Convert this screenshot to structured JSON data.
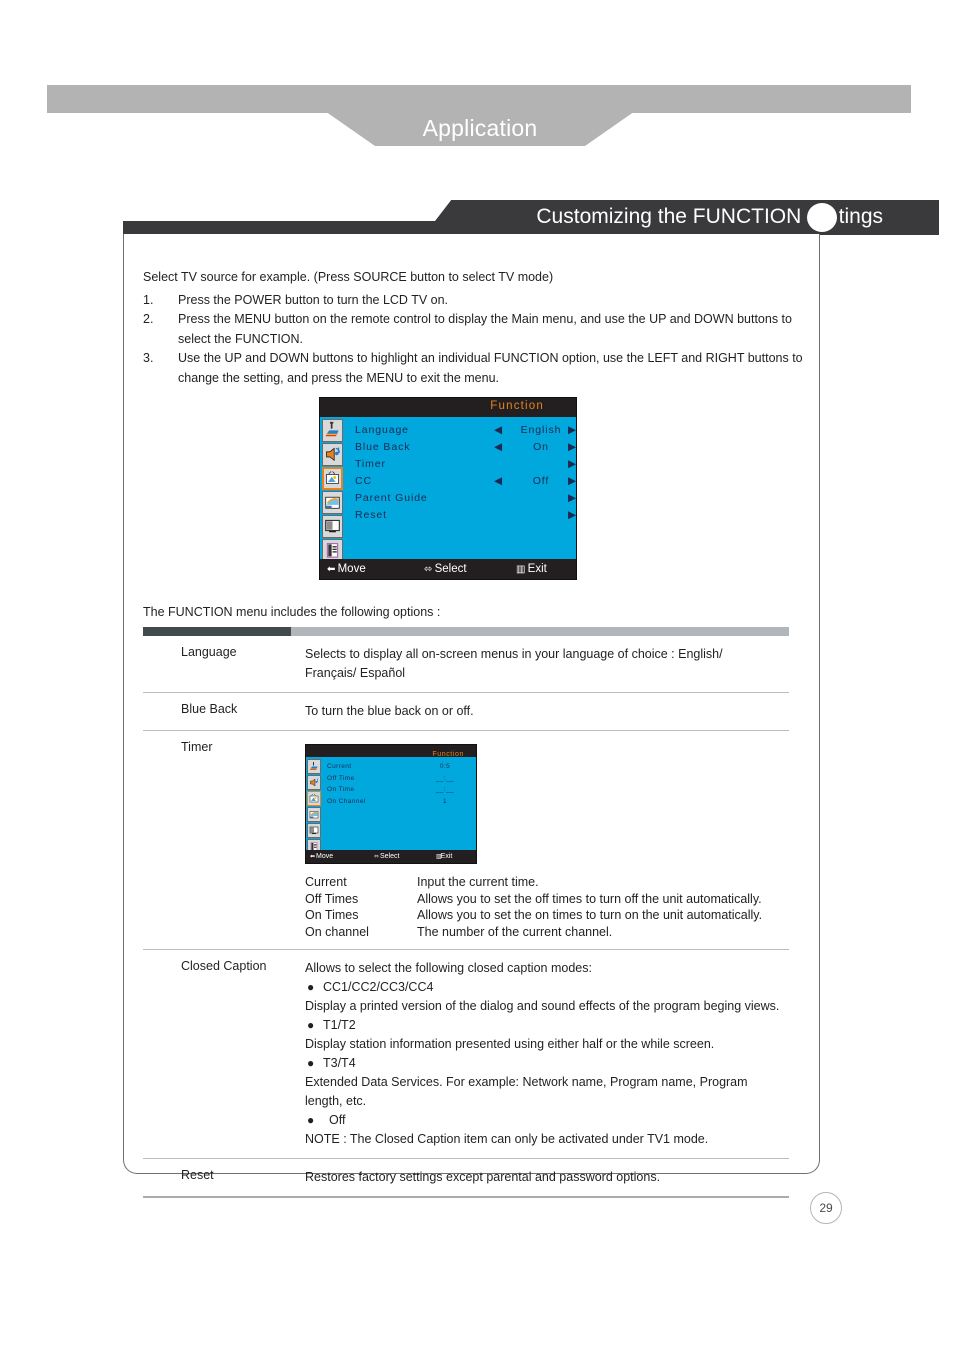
{
  "banner": {
    "chapter_title": "Application"
  },
  "section": {
    "title": "Customizing the FUNCTION Settings"
  },
  "intro": {
    "lead": "Select TV source for example. (Press SOURCE button to select TV mode)",
    "steps": [
      {
        "num": "1.",
        "text": "Press the POWER button to turn the LCD TV on."
      },
      {
        "num": "2.",
        "text": "Press the MENU button on the remote control to display the Main menu, and use the UP and DOWN buttons to select the FUNCTION."
      },
      {
        "num": "3.",
        "text": "Use the UP and DOWN buttons to highlight an individual FUNCTION option, use the LEFT and RIGHT buttons to change the setting, and press the MENU to exit the menu."
      }
    ]
  },
  "osd_main": {
    "title": "Function",
    "icons": [
      {
        "name": "picture-icon",
        "selected": false
      },
      {
        "name": "audio-icon",
        "selected": false
      },
      {
        "name": "function-icon",
        "selected": true
      },
      {
        "name": "setup-icon",
        "selected": false
      },
      {
        "name": "pip-icon",
        "selected": false
      },
      {
        "name": "input-icon",
        "selected": false
      }
    ],
    "rows": [
      {
        "label": "Language",
        "value": "English",
        "left_arrow": true,
        "right_arrow": true
      },
      {
        "label": "Blue Back",
        "value": "On",
        "left_arrow": true,
        "right_arrow": true
      },
      {
        "label": "Timer",
        "value": "",
        "left_arrow": false,
        "right_arrow": true
      },
      {
        "label": "CC",
        "value": "Off",
        "left_arrow": true,
        "right_arrow": true
      },
      {
        "label": "Parent Guide",
        "value": "",
        "left_arrow": false,
        "right_arrow": true
      },
      {
        "label": "Reset",
        "value": "",
        "left_arrow": false,
        "right_arrow": true
      }
    ],
    "footer": {
      "move": "Move",
      "select": "Select",
      "exit": "Exit",
      "move_glyph": "⬍",
      "select_glyph": "⬌",
      "exit_glyph": "▥"
    },
    "colors": {
      "body": "#00a8de",
      "titlebar": "#231f20",
      "title_text": "#e8821e",
      "row_text": "#1c2a52",
      "highlight": "#e8821e"
    }
  },
  "osd_timer": {
    "title": "Function",
    "icons": [
      {
        "name": "picture-icon",
        "selected": false
      },
      {
        "name": "audio-icon",
        "selected": false
      },
      {
        "name": "function-icon",
        "selected": true
      },
      {
        "name": "setup-icon",
        "selected": false
      },
      {
        "name": "pip-icon",
        "selected": false
      },
      {
        "name": "input-icon",
        "selected": false
      }
    ],
    "rows": [
      {
        "label": "Current",
        "value": "0:5"
      },
      {
        "label": "Off Time",
        "value": "__:__"
      },
      {
        "label": "On Time",
        "value": "__:__"
      },
      {
        "label": "On Channel",
        "value": "1"
      }
    ],
    "footer": {
      "move": "Move",
      "select": "Select",
      "exit": "Exit",
      "move_glyph": "⬍",
      "select_glyph": "⬌",
      "exit_glyph": "▥"
    }
  },
  "includes_line": "The FUNCTION menu includes the following options :",
  "table": {
    "language": {
      "term": "Language",
      "desc_line1": "Selects to display all on-screen menus in your language of choice : English/",
      "desc_line2": "Français/ Español"
    },
    "blue_back": {
      "term": "Blue Back",
      "desc": "To turn the blue back on or off."
    },
    "timer": {
      "term": "Timer",
      "defs": [
        {
          "key": "Current",
          "value": "Input the current time."
        },
        {
          "key": "Off Times",
          "value": "Allows you to set the off times to turn off the unit automatically."
        },
        {
          "key": "On Times",
          "value": "Allows you to set the on times to turn on the unit automatically."
        },
        {
          "key": "On channel",
          "value": "The number of the current channel."
        }
      ]
    },
    "closed_caption": {
      "term": "Closed Caption",
      "intro": "Allows to select the following closed caption modes:",
      "items": [
        {
          "bullet": "●",
          "mode": "CC1/CC2/CC3/CC4",
          "body": "Display a printed version of the dialog and sound effects of the program beging views."
        },
        {
          "bullet": "●",
          "mode": "T1/T2",
          "body": "Display station information presented using either half or the while screen."
        },
        {
          "bullet": "●",
          "mode": "T3/T4",
          "body": "Extended Data Services. For example: Network name, Program name, Program length, etc."
        },
        {
          "bullet": "●",
          "mode": "Off",
          "body": ""
        }
      ],
      "note": "NOTE : The Closed Caption item can only be activated under TV1 mode."
    },
    "reset": {
      "term": "Reset",
      "desc": "Restores factory settings except parental and password options."
    }
  },
  "page": {
    "number": "29"
  }
}
